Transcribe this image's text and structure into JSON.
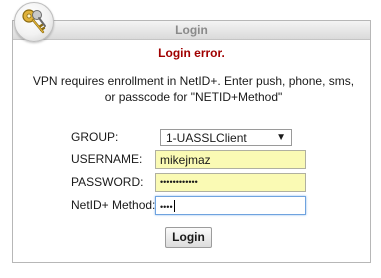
{
  "dialog": {
    "title": "Login",
    "error": "Login error.",
    "message": "VPN requires enrollment in NetID+. Enter push, phone, sms, or passcode for \"NETID+Method\""
  },
  "form": {
    "group_label": "GROUP:",
    "group_value": "1-UASSLClient",
    "username_label": "USERNAME:",
    "username_value": "mikejmaz",
    "password_label": "PASSWORD:",
    "password_value": "••••••••••••",
    "netid_label": "NetID+ Method:",
    "netid_value": "••••"
  },
  "login_button": "Login",
  "icons": {
    "logo": "keys-icon",
    "dropdown": "chevron-down-icon"
  },
  "colors": {
    "error": "#a00000",
    "autofill": "#fafab4",
    "focus": "#6fa3df"
  }
}
